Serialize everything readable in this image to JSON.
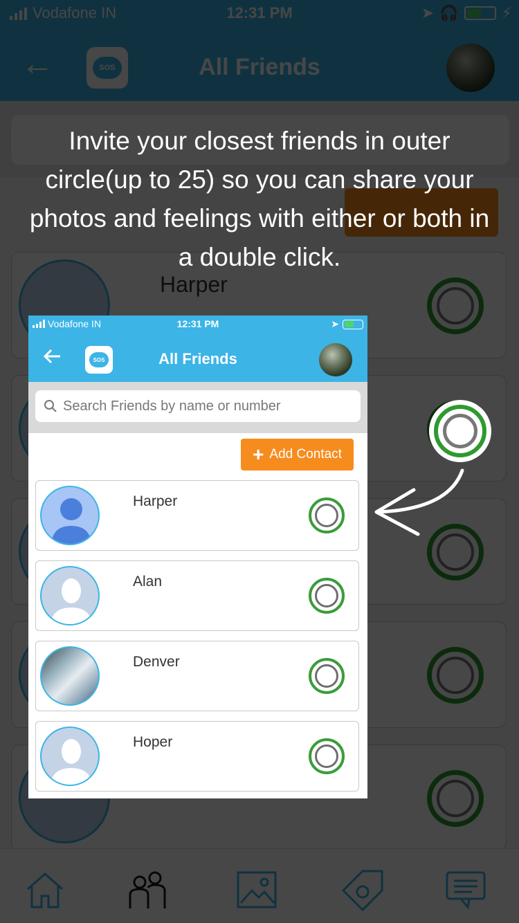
{
  "status_bar": {
    "carrier": "Vodafone IN",
    "time": "12:31 PM"
  },
  "header": {
    "title": "All Friends",
    "logo_text": "SOS"
  },
  "search": {
    "placeholder": "Search Friends by name or number"
  },
  "add_contact": {
    "label": "Add Contact"
  },
  "tip": {
    "text": "Invite your closest friends in outer circle(up to 25) so you can share your photos and feelings with either or both in a double click."
  },
  "friends": [
    {
      "name": "Harper"
    },
    {
      "name": "Alan"
    },
    {
      "name": "Denver"
    },
    {
      "name": "Hoper"
    }
  ],
  "tabbar": {
    "items": [
      "home-icon",
      "friends-icon",
      "gallery-icon",
      "tag-icon",
      "chat-icon"
    ]
  },
  "colors": {
    "primary": "#3cb4e6",
    "accent_orange": "#f78c1e",
    "ring_green": "#3a9d3a"
  }
}
